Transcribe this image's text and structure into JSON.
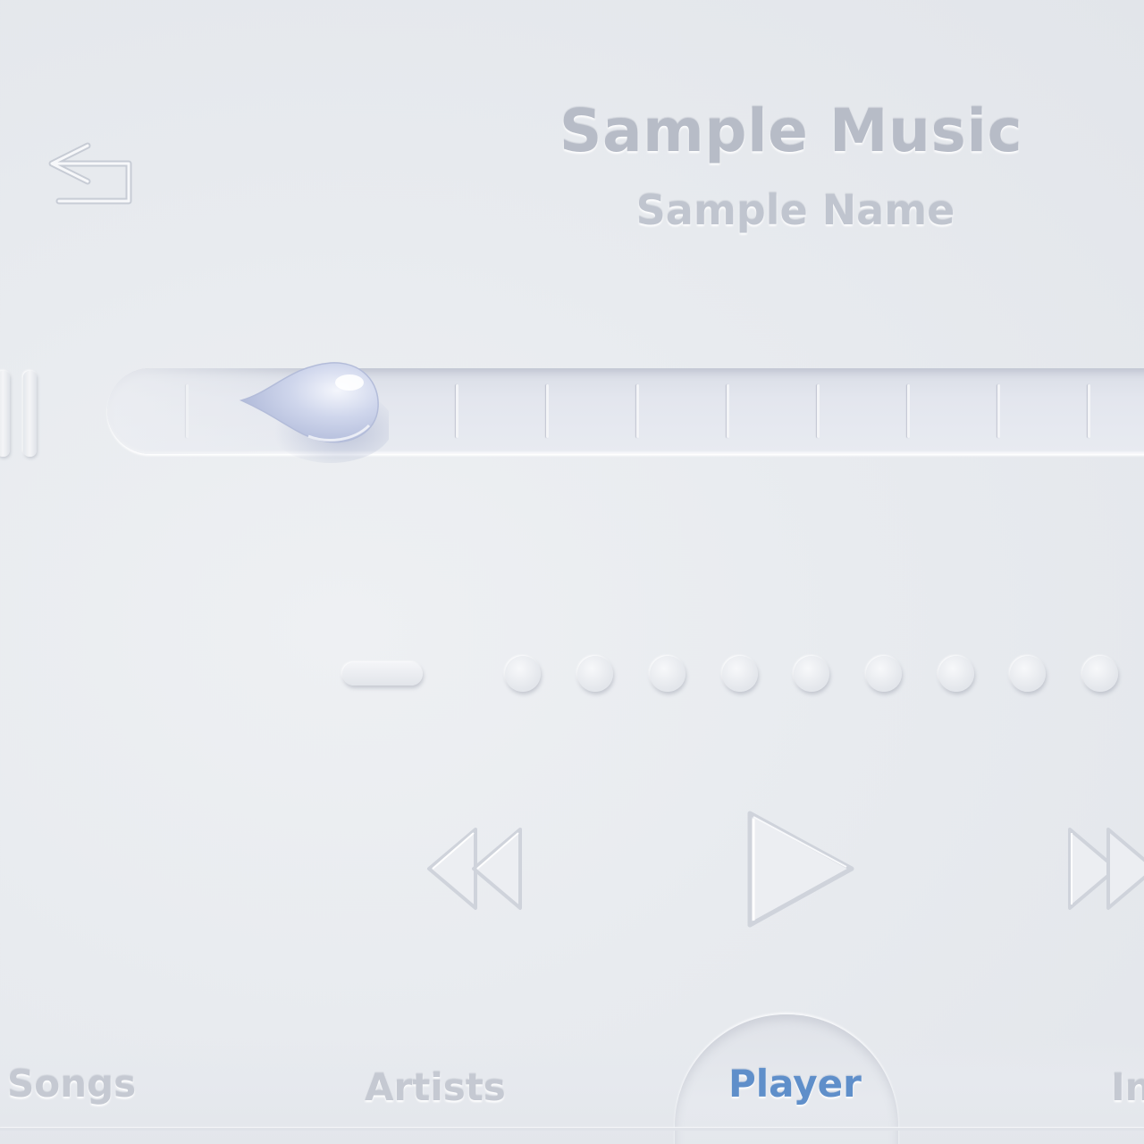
{
  "header": {
    "title": "Sample Music",
    "subtitle": "Sample Name"
  },
  "controls": {
    "back_icon": "back-arrow-icon",
    "pause_icon": "pause-icon",
    "rewind_icon": "rewind-icon",
    "play_icon": "play-icon",
    "fast_forward_icon": "fast-forward-icon"
  },
  "progress": {
    "value": 0.2,
    "thumb_style": "water-drop"
  },
  "page_indicator": {
    "active_index": 0
  },
  "tabs": [
    {
      "label": "Songs",
      "active": false
    },
    {
      "label": "Artists",
      "active": false
    },
    {
      "label": "Player",
      "active": true
    },
    {
      "label": "In",
      "active": false
    }
  ],
  "colors": {
    "background": "#e9ecf0",
    "text_muted": "#b7bcc7",
    "accent": "#5f8fca"
  }
}
